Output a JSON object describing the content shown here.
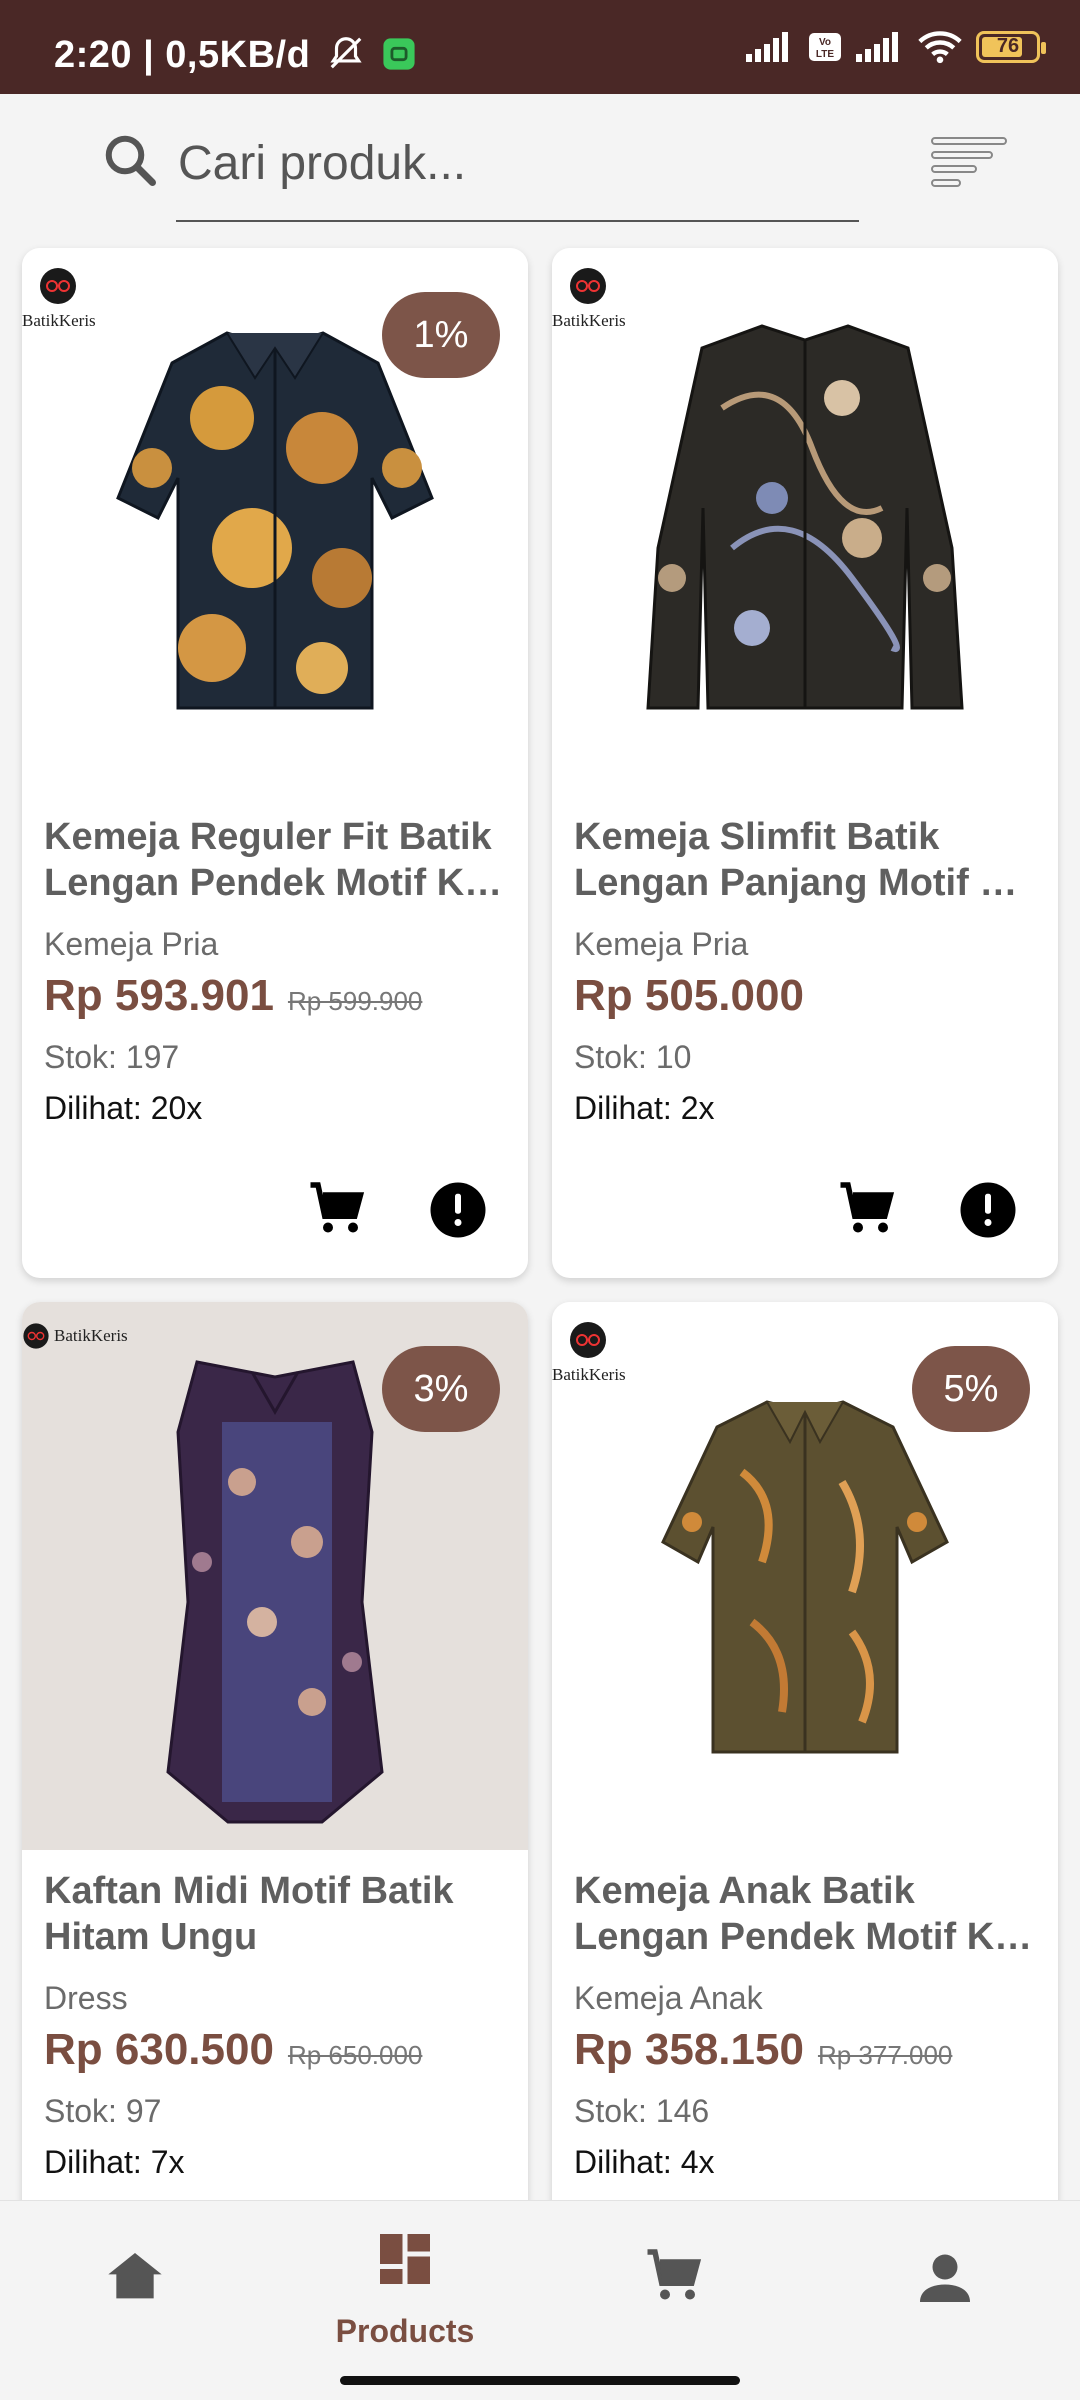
{
  "status_bar": {
    "time_network": "2:20 | 0,5KB/d",
    "battery": "76",
    "battery_level": 0.76,
    "volte": "Vo LTE"
  },
  "search": {
    "placeholder": "Cari produk..."
  },
  "products": [
    {
      "brand_logo": "BatikKeris",
      "discount": "1%",
      "name_line1": "Kemeja Reguler Fit Batik",
      "name_line2": "Lengan Pendek Motif Ke...",
      "category": "Kemeja Pria",
      "price": "Rp 593.901",
      "old_price": "Rp 599.900",
      "stock": "Stok: 197",
      "views": "Dilihat: 20x"
    },
    {
      "brand_logo": "BatikKeris",
      "discount": "",
      "name_line1": "Kemeja Slimfit Batik",
      "name_line2": "Lengan Panjang Motif K...",
      "category": "Kemeja Pria",
      "price": "Rp 505.000",
      "old_price": "",
      "stock": "Stok: 10",
      "views": "Dilihat: 2x"
    },
    {
      "brand_logo": "BatikKeris",
      "discount": "3%",
      "name_line1": "Kaftan Midi Motif Batik",
      "name_line2": "Hitam Ungu",
      "category": "Dress",
      "price": "Rp 630.500",
      "old_price": "Rp 650.000",
      "stock": "Stok: 97",
      "views": "Dilihat: 7x"
    },
    {
      "brand_logo": "BatikKeris",
      "discount": "5%",
      "name_line1": "Kemeja Anak Batik",
      "name_line2": "Lengan Pendek Motif Ke...",
      "category": "Kemeja Anak",
      "price": "Rp 358.150",
      "old_price": "Rp 377.000",
      "stock": "Stok: 146",
      "views": "Dilihat: 4x"
    }
  ],
  "bottom_nav": {
    "active": "Products",
    "items": [
      {
        "icon": "home-icon"
      },
      {
        "icon": "products-grid-icon",
        "label": "Products"
      },
      {
        "icon": "cart-icon"
      },
      {
        "icon": "profile-icon"
      }
    ]
  },
  "colors": {
    "status_bar": "#4a2826",
    "accent": "#7a4e41",
    "badge": "#7d5549"
  }
}
